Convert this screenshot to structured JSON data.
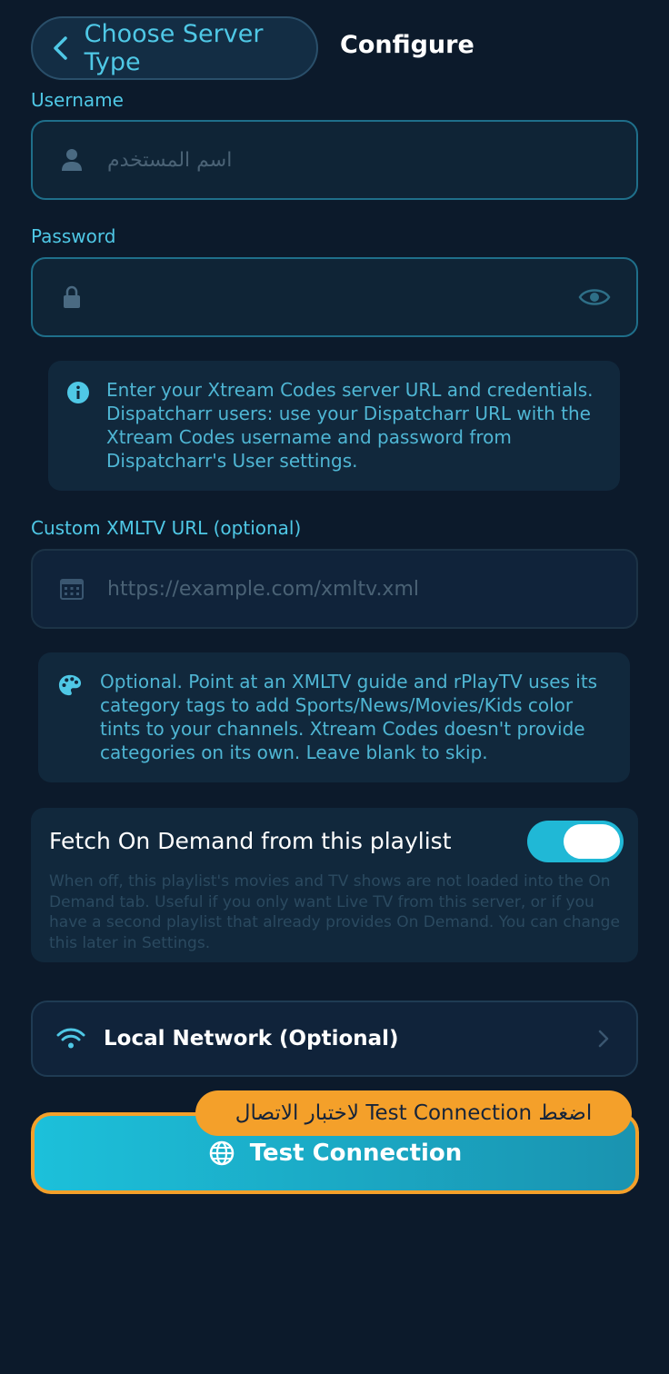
{
  "header": {
    "back_label": "Choose Server Type",
    "title": "Configure"
  },
  "username": {
    "label": "Username",
    "placeholder": "اسم المستخدم",
    "icon": "person-icon"
  },
  "password": {
    "label": "Password",
    "value": "",
    "icon": "lock-icon",
    "toggle_icon": "eye-icon"
  },
  "xtream_info": {
    "icon": "info-icon",
    "text": "Enter your Xtream Codes server URL and credentials. Dispatcharr users: use your Dispatcharr URL with the Xtream Codes username and password from Dispatcharr's User settings."
  },
  "xmltv": {
    "label": "Custom XMLTV URL (optional)",
    "placeholder": "https://example.com/xmltv.xml",
    "icon": "calendar-icon"
  },
  "xmltv_info": {
    "icon": "palette-icon",
    "text": "Optional. Point at an XMLTV guide and rPlayTV uses its category tags to add Sports/News/Movies/Kids color tints to your channels. Xtream Codes doesn't provide categories on its own. Leave blank to skip."
  },
  "on_demand": {
    "title": "Fetch On Demand from this playlist",
    "enabled": true,
    "description": "When off, this playlist's movies and TV shows are not loaded into the On Demand tab. Useful if you only want Live TV from this server, or if you have a second playlist that already provides On Demand. You can change this later in Settings."
  },
  "local_network": {
    "label": "Local Network (Optional)",
    "icon": "wifi-icon"
  },
  "test_connection": {
    "label": "Test Connection",
    "icon": "globe-icon"
  },
  "tooltip": {
    "text": "اضغط Test Connection لاختبار الاتصال"
  },
  "colors": {
    "background": "#0c1a2b",
    "accent": "#4fc8e6",
    "toggle_on": "#20b8d6",
    "highlight": "#f4a02a"
  }
}
